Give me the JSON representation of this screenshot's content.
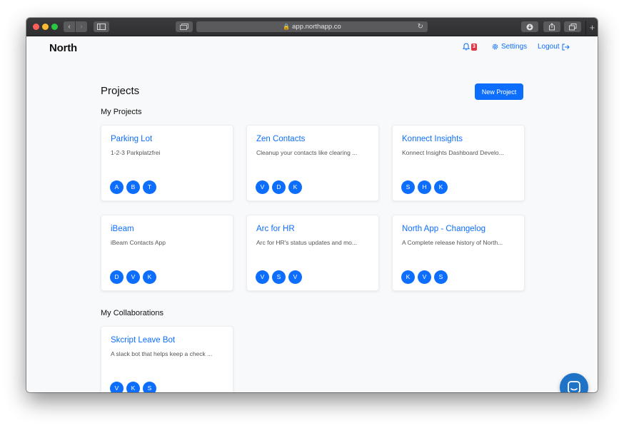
{
  "browser": {
    "url": "app.northapp.co"
  },
  "header": {
    "brand": "North",
    "notification_count": "3",
    "settings_label": "Settings",
    "logout_label": "Logout"
  },
  "main": {
    "title": "Projects",
    "new_project_label": "New Project",
    "my_projects_title": "My Projects",
    "collaborations_title": "My Collaborations",
    "my_projects": [
      {
        "title": "Parking Lot",
        "description": "1-2-3 Parkplatzfrei",
        "members": [
          "A",
          "B",
          "T"
        ]
      },
      {
        "title": "Zen Contacts",
        "description": "Cleanup your contacts like clearing ...",
        "members": [
          "V",
          "D",
          "K"
        ]
      },
      {
        "title": "Konnect Insights",
        "description": "Konnect Insights Dashboard Develo...",
        "members": [
          "S",
          "H",
          "K"
        ]
      },
      {
        "title": "iBeam",
        "description": "iBeam Contacts App",
        "members": [
          "D",
          "V",
          "K"
        ]
      },
      {
        "title": "Arc for HR",
        "description": "Arc for HR's status updates and mo...",
        "members": [
          "V",
          "S",
          "V"
        ]
      },
      {
        "title": "North App - Changelog",
        "description": "A Complete release history of North...",
        "members": [
          "K",
          "V",
          "S"
        ]
      }
    ],
    "collaborations": [
      {
        "title": "Skcript Leave Bot",
        "description": "A slack bot that helps keep a check ...",
        "members": [
          "V",
          "K",
          "S"
        ]
      }
    ]
  },
  "icons": {
    "notification": "bell-icon",
    "settings": "gear-icon",
    "logout": "logout-icon",
    "chat": "chat-icon"
  },
  "colors": {
    "accent": "#0d6efd",
    "badge": "#dc3545",
    "chat": "#1f73c6"
  }
}
